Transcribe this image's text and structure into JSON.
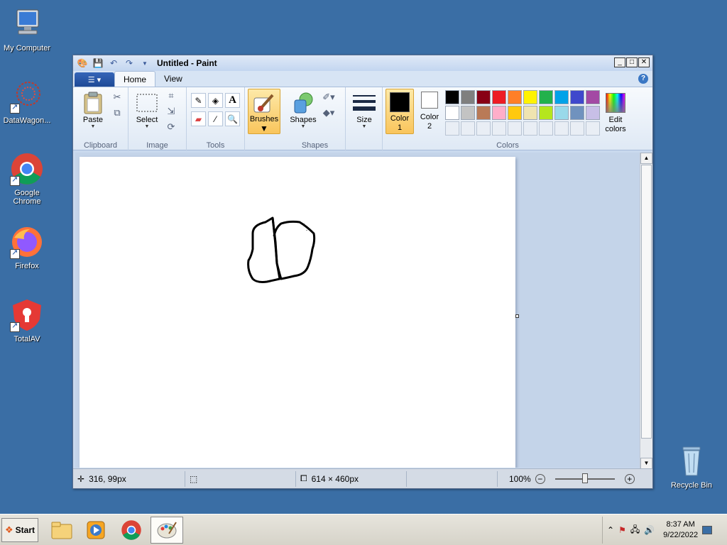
{
  "desktop": {
    "icons": [
      {
        "label": "My Computer"
      },
      {
        "label": "DataWagon..."
      },
      {
        "label": "Google Chrome"
      },
      {
        "label": "Firefox"
      },
      {
        "label": "TotalAV"
      },
      {
        "label": "Recycle Bin"
      }
    ]
  },
  "window": {
    "title": "Untitled - Paint",
    "tabs": [
      "Home",
      "View"
    ],
    "help": "?"
  },
  "ribbon": {
    "clipboard": {
      "label": "Clipboard",
      "paste": "Paste"
    },
    "image": {
      "label": "Image",
      "select": "Select"
    },
    "tools": {
      "label": "Tools",
      "text_tool": "A"
    },
    "brushes": {
      "label": "Brushes"
    },
    "shapes": {
      "label": "Shapes",
      "shapes_btn": "Shapes"
    },
    "size": {
      "label": "Size"
    },
    "colors": {
      "label": "Colors",
      "color1_line1": "Color",
      "color1_line2": "1",
      "color2_line1": "Color",
      "color2_line2": "2",
      "edit_line1": "Edit",
      "edit_line2": "colors",
      "color1": "#000000",
      "color2": "#ffffff",
      "palette_row1": [
        "#000000",
        "#7f7f7f",
        "#880015",
        "#ed1c24",
        "#ff7f27",
        "#fff200",
        "#22b14c",
        "#00a2e8",
        "#3f48cc",
        "#a349a4"
      ],
      "palette_row2": [
        "#ffffff",
        "#c3c3c3",
        "#b97a57",
        "#ffaec9",
        "#ffc90e",
        "#efe4b0",
        "#b5e61d",
        "#99d9ea",
        "#7092be",
        "#c8bfe7"
      ]
    }
  },
  "status": {
    "cursor_pos": "316, 99px",
    "image_size": "614 × 460px",
    "zoom": "100%"
  },
  "taskbar": {
    "start": "Start",
    "time": "8:37 AM",
    "date": "9/22/2022"
  }
}
